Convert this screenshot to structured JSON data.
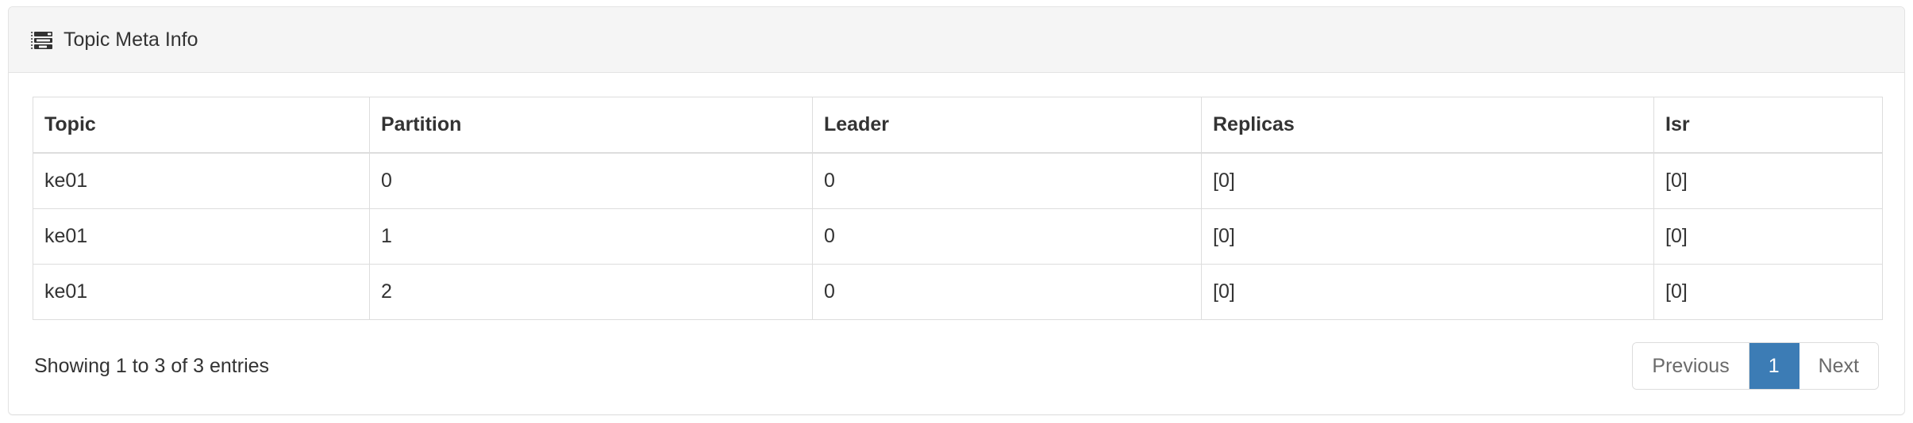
{
  "panel": {
    "title": "Topic Meta Info",
    "icon": "server-list-icon",
    "header_bg": "#f5f5f5",
    "border_color": "#e3e3e3"
  },
  "table": {
    "columns": [
      "Topic",
      "Partition",
      "Leader",
      "Replicas",
      "Isr"
    ],
    "rows": [
      {
        "topic": "ke01",
        "partition": "0",
        "leader": "0",
        "replicas": "[0]",
        "isr": "[0]"
      },
      {
        "topic": "ke01",
        "partition": "1",
        "leader": "0",
        "replicas": "[0]",
        "isr": "[0]"
      },
      {
        "topic": "ke01",
        "partition": "2",
        "leader": "0",
        "replicas": "[0]",
        "isr": "[0]"
      }
    ]
  },
  "footer": {
    "info": "Showing 1 to 3 of 3 entries",
    "pagination": {
      "previous_label": "Previous",
      "page_label": "1",
      "next_label": "Next",
      "active_color": "#3c7cb5"
    }
  }
}
